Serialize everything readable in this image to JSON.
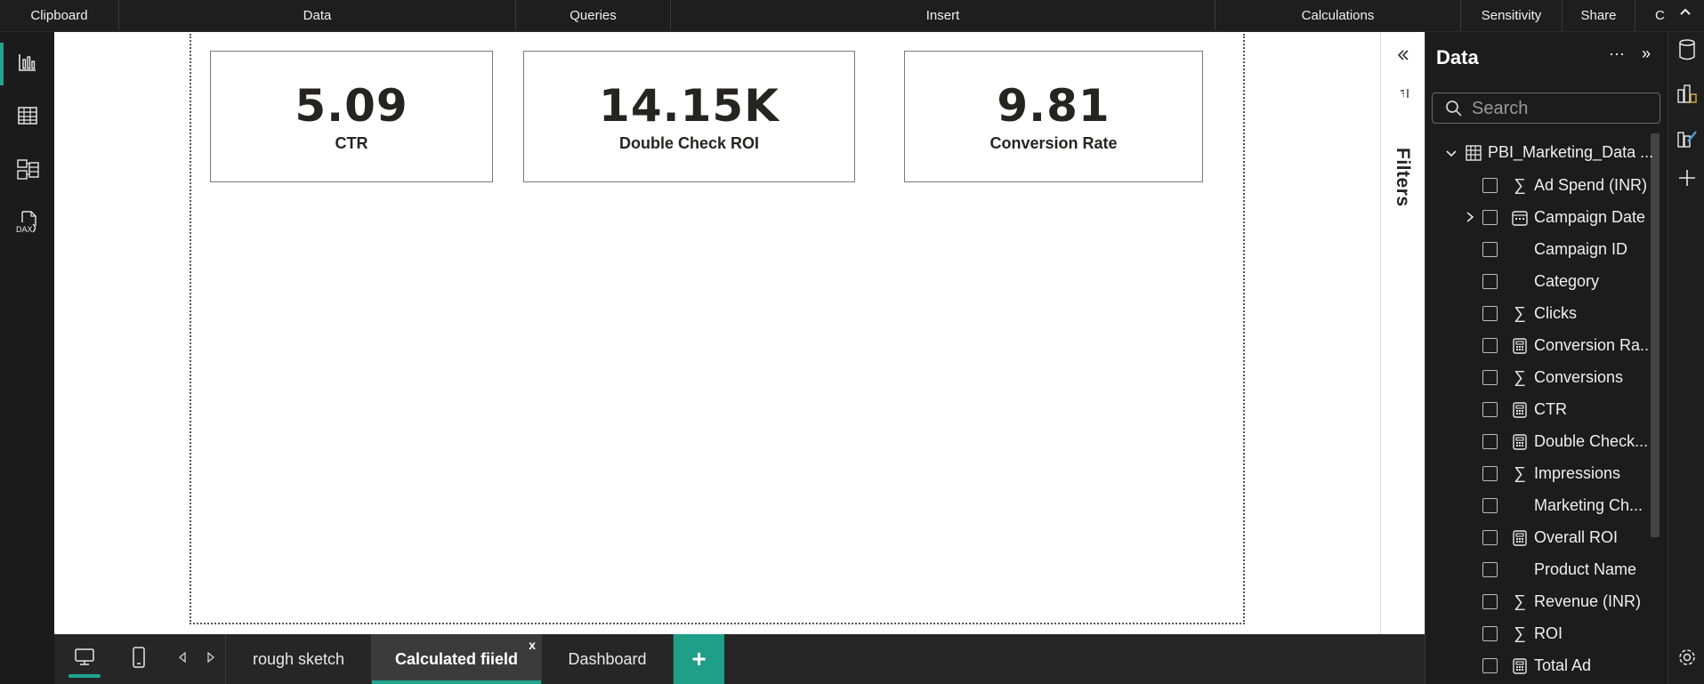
{
  "ribbon": {
    "groups": [
      "Clipboard",
      "Data",
      "Queries",
      "Insert",
      "Calculations",
      "Sensitivity",
      "Share",
      "C"
    ],
    "collapse_icon": "chevron-up-icon"
  },
  "left_rail": {
    "items": [
      {
        "name": "report-view",
        "icon": "bar-chart-icon",
        "active": true
      },
      {
        "name": "table-view",
        "icon": "table-grid-icon",
        "active": false
      },
      {
        "name": "model-view",
        "icon": "model-diagram-icon",
        "active": false
      },
      {
        "name": "dax-query-view",
        "icon": "dax-icon",
        "label": "DAX",
        "active": false
      }
    ]
  },
  "cards": [
    {
      "value": "5.09",
      "label": "CTR"
    },
    {
      "value": "14.15K",
      "label": "Double Check ROI"
    },
    {
      "value": "9.81",
      "label": "Conversion Rate"
    }
  ],
  "filters": {
    "label": "Filters",
    "collapse_icon": "double-chevron-left-icon"
  },
  "data_pane": {
    "title": "Data",
    "more_label": "···",
    "expand_label": "»",
    "search_placeholder": "Search",
    "table_name": "PBI_Marketing_Data ...",
    "fields": [
      {
        "name": "Ad Spend (INR)",
        "icon": "sigma",
        "expandable": false
      },
      {
        "name": "Campaign Date",
        "icon": "calendar",
        "expandable": true
      },
      {
        "name": "Campaign ID",
        "icon": "none",
        "expandable": false
      },
      {
        "name": "Category",
        "icon": "none",
        "expandable": false
      },
      {
        "name": "Clicks",
        "icon": "sigma",
        "expandable": false
      },
      {
        "name": "Conversion Ra...",
        "icon": "calculator",
        "expandable": false
      },
      {
        "name": "Conversions",
        "icon": "sigma",
        "expandable": false
      },
      {
        "name": "CTR",
        "icon": "calculator",
        "expandable": false
      },
      {
        "name": "Double Check...",
        "icon": "calculator",
        "expandable": false
      },
      {
        "name": "Impressions",
        "icon": "sigma",
        "expandable": false
      },
      {
        "name": "Marketing Ch...",
        "icon": "none",
        "expandable": false
      },
      {
        "name": "Overall ROI",
        "icon": "calculator",
        "expandable": false
      },
      {
        "name": "Product Name",
        "icon": "none",
        "expandable": false
      },
      {
        "name": "Revenue (INR)",
        "icon": "sigma",
        "expandable": false
      },
      {
        "name": "ROI",
        "icon": "sigma",
        "expandable": false
      },
      {
        "name": "Total Ad",
        "icon": "calculator",
        "expandable": false
      }
    ]
  },
  "right_rail": {
    "items": [
      "data-cylinder-icon",
      "build-visual-icon",
      "format-brush-icon",
      "add-icon",
      "settings-gear-icon"
    ]
  },
  "tabbar": {
    "view_icons": [
      "desktop-layout-icon",
      "mobile-layout-icon"
    ],
    "nav_icons": [
      "prev-page-icon",
      "next-page-icon"
    ],
    "tabs": [
      {
        "label": "rough sketch",
        "active": false
      },
      {
        "label": "Calculated fiield",
        "active": true,
        "close": "x"
      },
      {
        "label": "Dashboard",
        "active": false
      }
    ],
    "add_label": "+"
  }
}
